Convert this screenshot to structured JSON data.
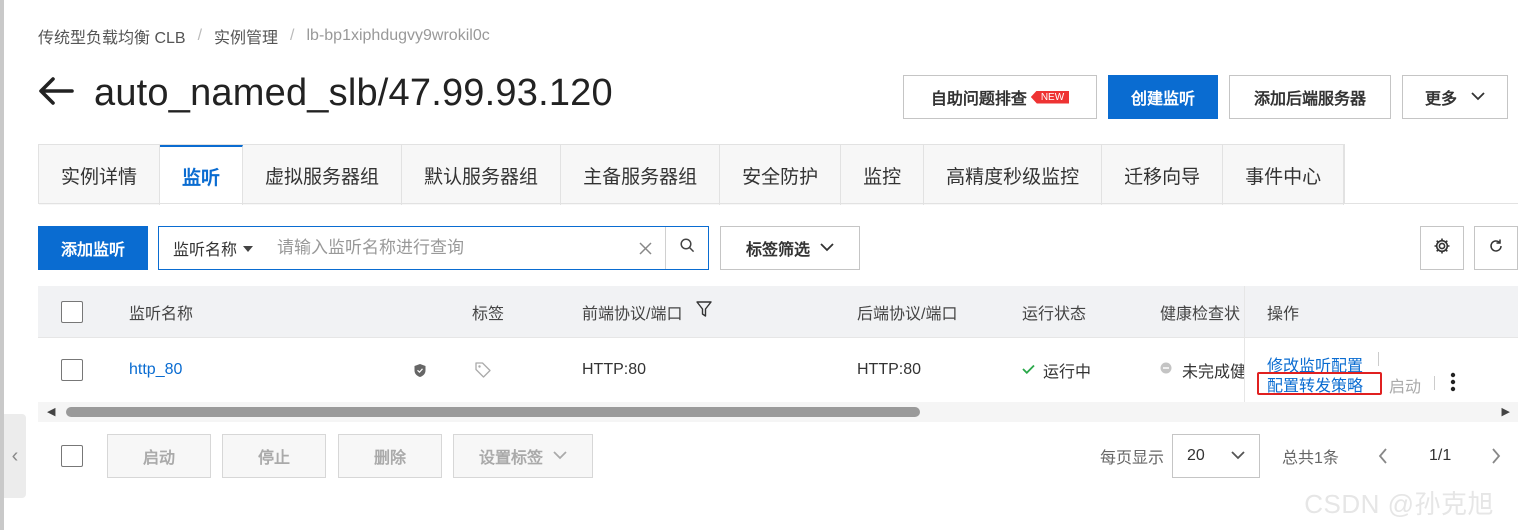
{
  "breadcrumb": [
    "传统型负载均衡 CLB",
    "实例管理",
    "lb-bp1xiphdugvy9wrokil0c"
  ],
  "page_title": "auto_named_slb/47.99.93.120",
  "header_actions": {
    "troubleshoot": "自助问题排查",
    "new_badge": "NEW",
    "create_listener": "创建监听",
    "add_backend": "添加后端服务器",
    "more": "更多"
  },
  "tabs": [
    "实例详情",
    "监听",
    "虚拟服务器组",
    "默认服务器组",
    "主备服务器组",
    "安全防护",
    "监控",
    "高精度秒级监控",
    "迁移向导",
    "事件中心"
  ],
  "active_tab": "监听",
  "toolbar": {
    "add_listener": "添加监听",
    "search_field": "监听名称",
    "search_placeholder": "请输入监听名称进行查询",
    "tag_filter": "标签筛选"
  },
  "table": {
    "columns": [
      "监听名称",
      "标签",
      "前端协议/端口",
      "后端协议/端口",
      "运行状态",
      "健康检查状",
      "操作"
    ],
    "rows": [
      {
        "name": "http_80",
        "frontend": "HTTP:80",
        "backend": "HTTP:80",
        "status": "运行中",
        "health": "未完成健",
        "op_modify": "修改监听配置",
        "op_forward": "配置转发策略",
        "op_start": "启动"
      }
    ]
  },
  "footer": {
    "start": "启动",
    "stop": "停止",
    "delete": "删除",
    "set_tags": "设置标签",
    "per_page_label": "每页显示",
    "per_page": "20",
    "total": "总共1条",
    "page": "1/1"
  },
  "watermark": "CSDN @孙克旭",
  "colors": {
    "primary": "#0a6cd1",
    "new_badge": "#e33333",
    "running": "#2aa84a",
    "highlight_box": "#e02020"
  }
}
